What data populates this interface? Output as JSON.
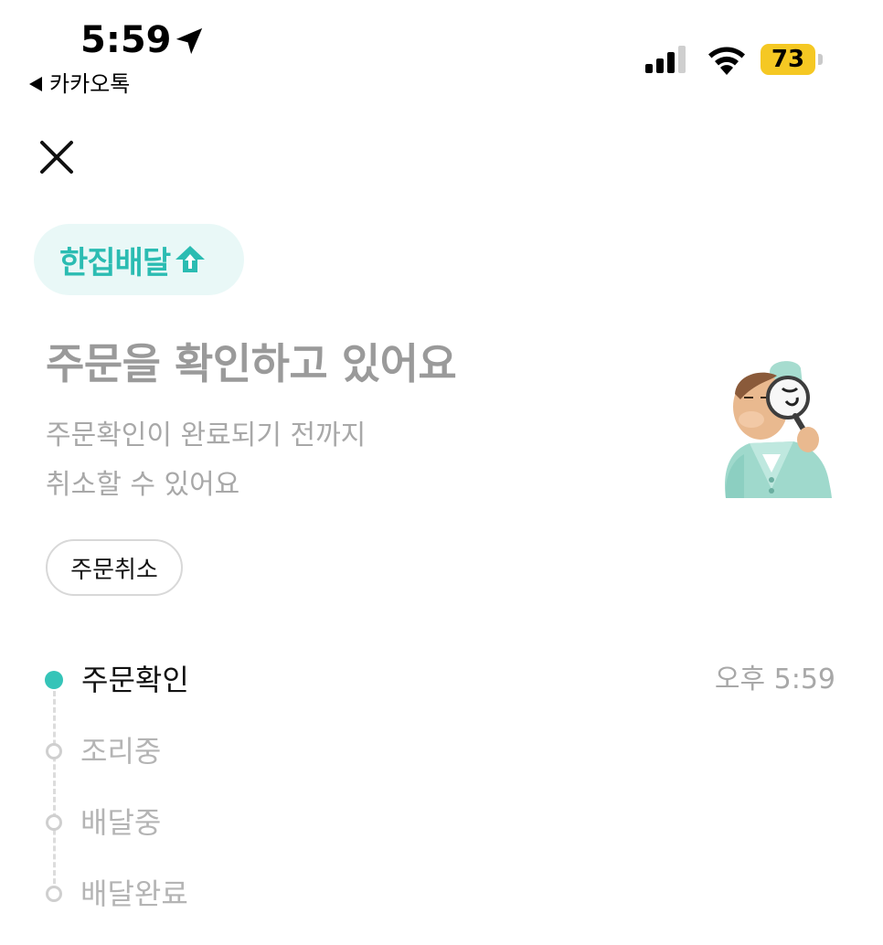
{
  "status_bar": {
    "time": "5:59",
    "back_app": "카카오톡",
    "battery": "73",
    "battery_color": "#f5c823"
  },
  "header": {
    "close_icon": "close-icon"
  },
  "brand": {
    "name": "한집배달",
    "icon": "home-arrow-icon",
    "color": "#2bbcb2"
  },
  "main": {
    "title": "주문을 확인하고 있어요",
    "description_line1": "주문확인이 완료되기 전까지",
    "description_line2": "취소할 수 있어요",
    "cancel_button": "주문취소"
  },
  "timeline": {
    "accent_color": "#35c4b8",
    "steps": [
      {
        "label": "주문확인",
        "time": "오후 5:59",
        "active": true
      },
      {
        "label": "조리중",
        "active": false
      },
      {
        "label": "배달중",
        "active": false
      },
      {
        "label": "배달완료",
        "active": false
      }
    ]
  }
}
